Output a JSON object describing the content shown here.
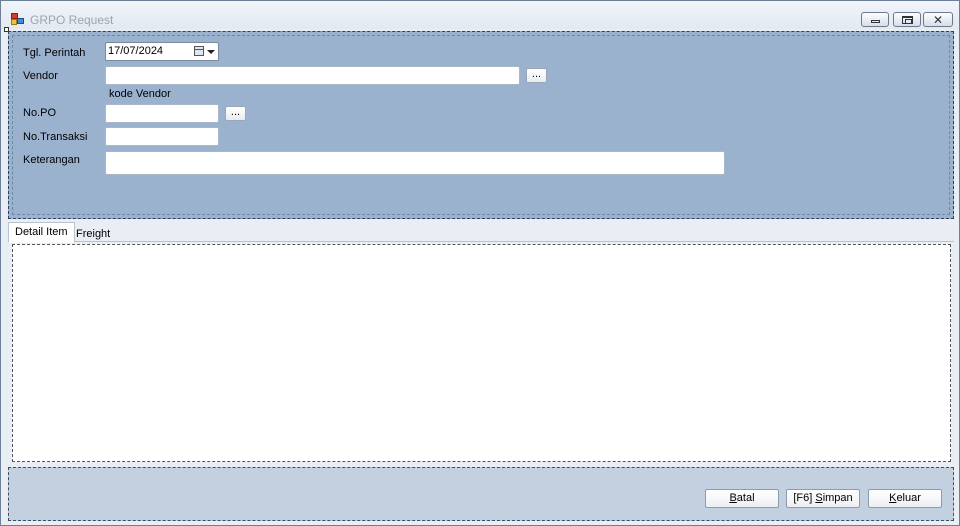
{
  "window": {
    "title": "GRPO Request",
    "controls": {
      "minimize": "minimize",
      "maximize": "maximize",
      "close": "✕"
    }
  },
  "form": {
    "tgl_perintah_label": "Tgl. Perintah",
    "tgl_perintah_value": "17/07/2024",
    "vendor_label": "Vendor",
    "vendor_value": "",
    "vendor_lookup": "...",
    "kode_vendor_label": "kode Vendor",
    "no_po_label": "No.PO",
    "no_po_value": "",
    "no_po_lookup": "...",
    "no_transaksi_label": "No.Transaksi",
    "no_transaksi_value": "",
    "keterangan_label": "Keterangan",
    "keterangan_value": ""
  },
  "tabs": [
    {
      "label": "Detail Item",
      "active": true
    },
    {
      "label": "Freight",
      "active": false
    }
  ],
  "actions": {
    "batal": {
      "prefix": "",
      "accel": "B",
      "rest": "atal"
    },
    "simpan": {
      "prefix": "[F6] ",
      "accel": "S",
      "rest": "impan"
    },
    "keluar": {
      "prefix": "",
      "accel": "K",
      "rest": "eluar"
    }
  },
  "colors": {
    "form_panel": "#9bb2cf",
    "bottom_panel": "#c3d0df",
    "window_bg": "#e9eef5"
  }
}
